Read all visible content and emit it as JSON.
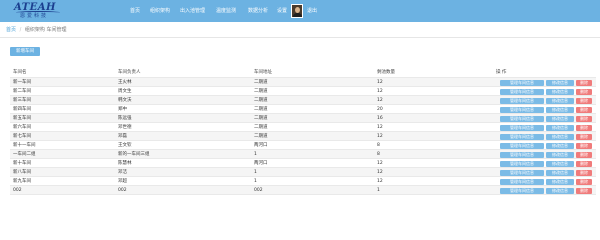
{
  "brand": {
    "logo_text": "ATEAH",
    "logo_sub": "恩爱科技"
  },
  "nav": [
    {
      "label": "首页"
    },
    {
      "label": "组织架构"
    },
    {
      "label": "出入池管理"
    },
    {
      "label": "温度监测"
    },
    {
      "label": "数据分析"
    },
    {
      "label": "设置"
    }
  ],
  "user": {
    "logout_label": "退出"
  },
  "breadcrumb": {
    "home": "首页",
    "sep": "/",
    "current": "组织架构 车间管理"
  },
  "toolbar": {
    "new_label": "新增车间"
  },
  "table": {
    "headers": [
      "车间名",
      "车间负责人",
      "车间地址",
      "剩池数量",
      "操 作"
    ],
    "actions": {
      "manage": "管理车间信息",
      "edit": "修改信息",
      "delete": "删除"
    },
    "rows": [
      [
        "新一车间",
        "王火林",
        "二期道",
        "12"
      ],
      [
        "新二车间",
        "周文生",
        "二期道",
        "12"
      ],
      [
        "新三车间",
        "韩文沃",
        "二期道",
        "12"
      ],
      [
        "新四车间",
        "郑中",
        "二期道",
        "20"
      ],
      [
        "新五车间",
        "陈远强",
        "二期道",
        "16"
      ],
      [
        "新六车间",
        "邓世德",
        "二期道",
        "12"
      ],
      [
        "新七车间",
        "邓磊",
        "二期道",
        "12"
      ],
      [
        "新十一车间",
        "王文钦",
        "两河口",
        "8"
      ],
      [
        "一车间二组",
        "新的一车间三组",
        "1",
        "8"
      ],
      [
        "新十车间",
        "陈慧林",
        "两河口",
        "12"
      ],
      [
        "新八车间",
        "邓洁",
        "1",
        "12"
      ],
      [
        "新九车间",
        "邓超",
        "1",
        "12"
      ],
      [
        "002",
        "002",
        "002",
        "1"
      ]
    ]
  },
  "colors": {
    "nav_bg": "#6cb2e2",
    "primary_button": "#7bbbe6",
    "danger_button": "#f07b7b"
  }
}
